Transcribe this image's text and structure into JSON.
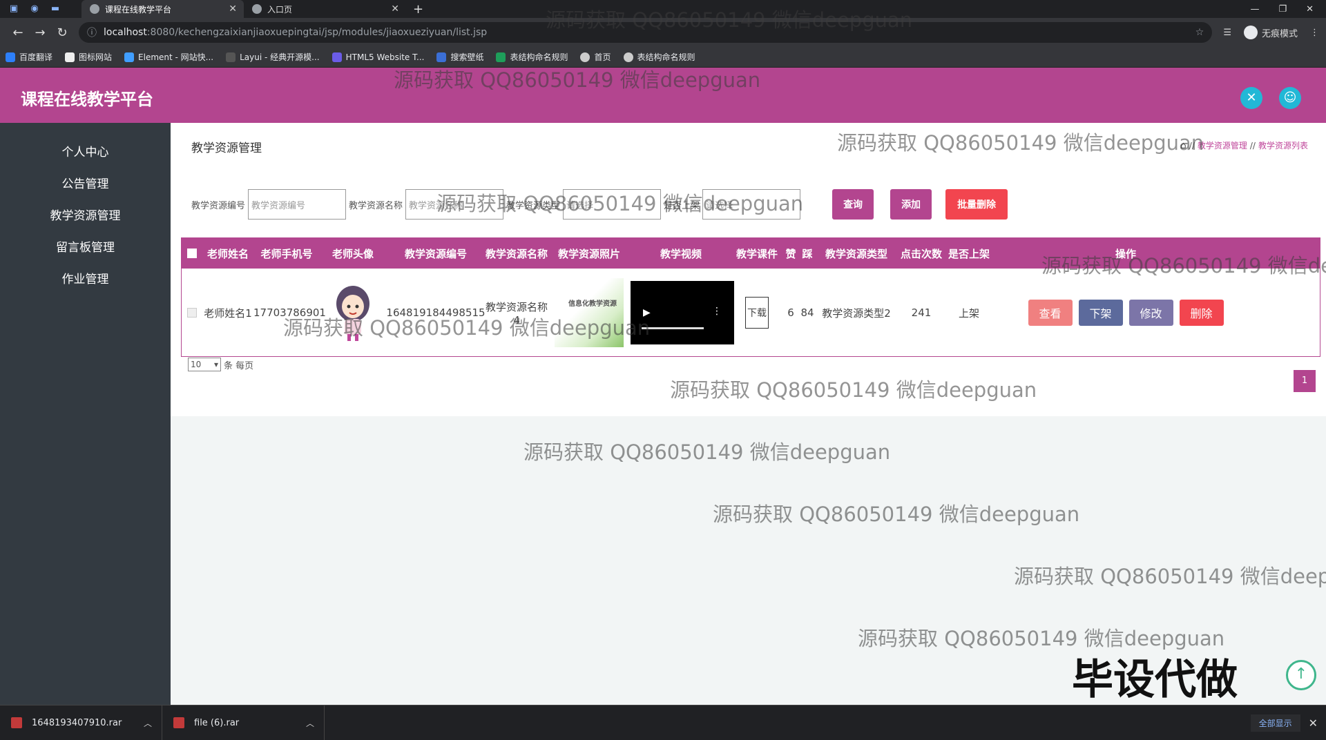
{
  "browser": {
    "tabs": [
      {
        "title": "课程在线教学平台",
        "active": true
      },
      {
        "title": "入口页",
        "active": false
      }
    ],
    "url_host": "localhost",
    "url_path": ":8080/kechengzaixianjiaoxuepingtai/jsp/modules/jiaoxueziyuan/list.jsp",
    "incognito_label": "无痕模式",
    "bookmarks": [
      "百度翻译",
      "图标网站",
      "Element - 网站快...",
      "Layui - 经典开源模...",
      "HTML5 Website T...",
      "搜索壁纸",
      "表结构命名规则",
      "首页",
      "表结构命名规则"
    ]
  },
  "app": {
    "title": "课程在线教学平台",
    "accent": "#b3458f"
  },
  "sidebar": {
    "items": [
      "个人中心",
      "公告管理",
      "教学资源管理",
      "留言板管理",
      "作业管理"
    ]
  },
  "page": {
    "title": "教学资源管理",
    "breadcrumb": [
      "教学资源管理",
      "教学资源列表"
    ]
  },
  "search": {
    "labels": [
      "教学资源编号",
      "教学资源名称",
      "教学资源类型",
      "是否上架"
    ],
    "placeholders": [
      "教学资源编号",
      "教学资源名称",
      "请选择",
      "请选择"
    ],
    "query": "查询",
    "add": "添加",
    "batch_delete": "批量删除"
  },
  "table": {
    "headers": [
      "老师姓名",
      "老师手机号",
      "老师头像",
      "教学资源编号",
      "教学资源名称",
      "教学资源照片",
      "教学视频",
      "教学课件",
      "赞",
      "踩",
      "教学资源类型",
      "点击次数",
      "是否上架",
      "操作"
    ],
    "rows": [
      {
        "teacher_name": "老师姓名1",
        "phone": "17703786901",
        "resource_no": "164819184498515",
        "resource_name": "教学资源名称4",
        "photo_caption": "信息化教学资源",
        "courseware": "下载",
        "likes": "6",
        "dislikes": "84",
        "type": "教学资源类型2",
        "clicks": "241",
        "listed": "上架"
      }
    ],
    "actions": [
      "查看",
      "下架",
      "修改",
      "删除"
    ]
  },
  "pagination": {
    "page_size": "10",
    "per_page_label": "条 每页",
    "current": "1"
  },
  "watermarks": [
    "源码获取 QQ86050149 微信deepguan",
    "毕设代做"
  ],
  "downloads": {
    "files": [
      "1648193407910.rar",
      "file (6).rar"
    ],
    "show_all": "全部显示"
  }
}
